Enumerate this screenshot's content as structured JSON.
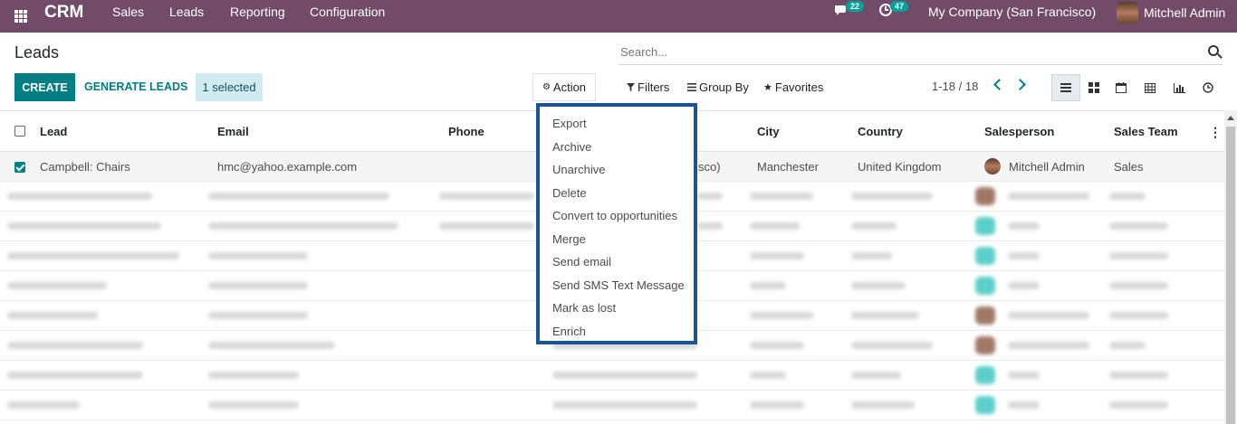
{
  "topbar": {
    "app_name": "CRM",
    "menu": [
      "Sales",
      "Leads",
      "Reporting",
      "Configuration"
    ],
    "messages_count": "22",
    "activities_count": "47",
    "company": "My Company (San Francisco)",
    "user_name": "Mitchell Admin"
  },
  "page": {
    "title": "Leads",
    "search_placeholder": "Search..."
  },
  "toolbar": {
    "create_label": "CREATE",
    "generate_label": "GENERATE LEADS",
    "selected_label": "1 selected",
    "action_label": "Action",
    "filters_label": "Filters",
    "groupby_label": "Group By",
    "favorites_label": "Favorites",
    "pager": "1-18 / 18"
  },
  "table": {
    "columns": [
      "Lead",
      "Email",
      "Phone",
      "City",
      "Country",
      "Salesperson",
      "Sales Team"
    ],
    "first_row": {
      "lead": "Campbell: Chairs",
      "email": "hmc@yahoo.example.com",
      "company_fragment": "sco)",
      "city": "Manchester",
      "country": "United Kingdom",
      "salesperson": "Mitchell Admin",
      "team": "Sales"
    }
  },
  "action_menu": [
    "Export",
    "Archive",
    "Unarchive",
    "Delete",
    "Convert to opportunities",
    "Merge",
    "Send email",
    "Send SMS Text Message",
    "Mark as lost",
    "Enrich"
  ],
  "colors": {
    "brand": "#714b67",
    "primary": "#017e84",
    "highlight_border": "#1a5497"
  }
}
